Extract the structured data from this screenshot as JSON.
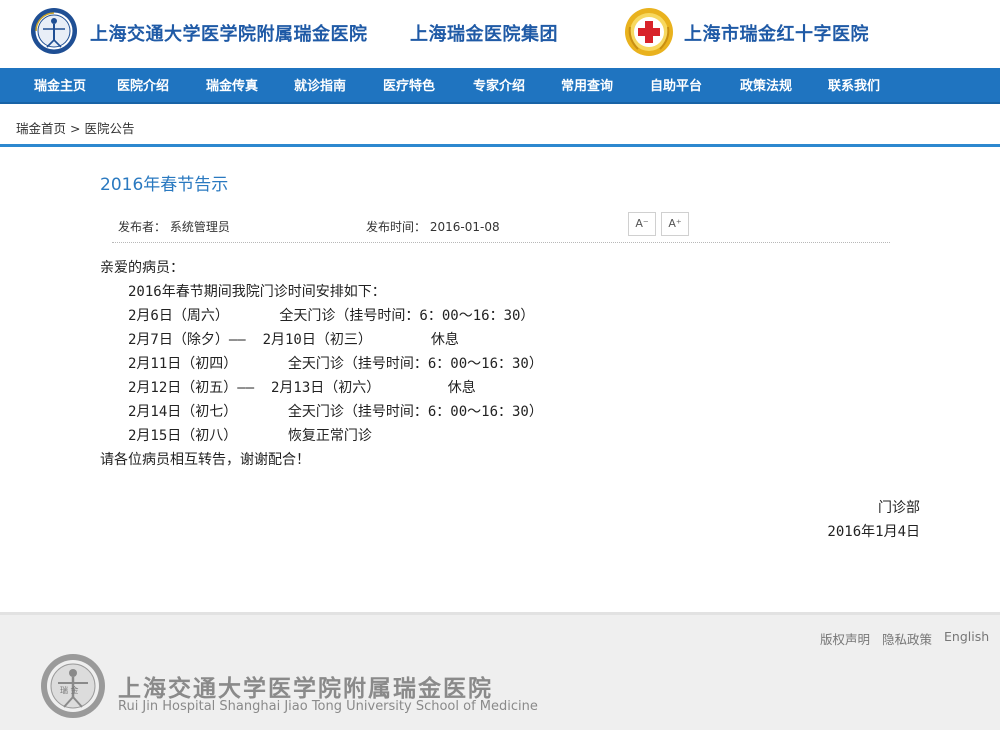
{
  "header": {
    "name_main": "上海交通大学医学院附属瑞金医院",
    "name_group": "上海瑞金医院集团",
    "name_redcross": "上海市瑞金红十字医院"
  },
  "nav": {
    "items": [
      "瑞金主页",
      "医院介绍",
      "瑞金传真",
      "就诊指南",
      "医疗特色",
      "专家介绍",
      "常用查询",
      "自助平台",
      "政策法规",
      "联系我们"
    ]
  },
  "breadcrumb": {
    "home": "瑞金首页",
    "sep": ">",
    "current": "医院公告"
  },
  "article": {
    "title": "2016年春节告示",
    "publisher_label": "发布者：",
    "publisher": "系统管理员",
    "time_label": "发布时间：",
    "time": "2016-01-08",
    "font_smaller": "A⁻",
    "font_larger": "A⁺",
    "greeting": "亲爱的病员：",
    "intro": "2016年春节期间我院门诊时间安排如下：",
    "schedule": [
      "2月6日（周六）      全天门诊（挂号时间：6：00～16：30）",
      "2月7日（除夕）——  2月10日（初三）       休息",
      "2月11日（初四）      全天门诊（挂号时间：6：00～16：30）",
      "2月12日（初五）——  2月13日（初六）        休息",
      "2月14日（初七）      全天门诊（挂号时间：6：00～16：30）",
      "2月15日（初八）      恢复正常门诊"
    ],
    "closing": "请各位病员相互转告，谢谢配合！",
    "signature": "门诊部",
    "date": "2016年1月4日"
  },
  "footer": {
    "links": [
      "版权声明",
      "隐私政策",
      "English"
    ],
    "name_cn": "上海交通大学医学院附属瑞金医院",
    "name_en": "Rui Jin Hospital Shanghai Jiao Tong University School of Medicine",
    "logo_text": "瑞 金"
  }
}
